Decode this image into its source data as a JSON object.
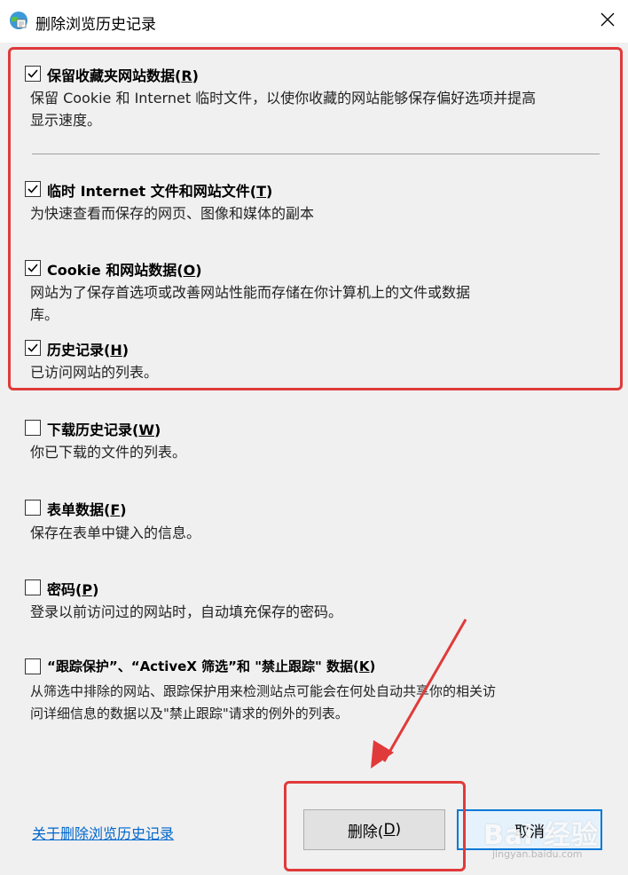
{
  "window": {
    "title": "删除浏览历史记录"
  },
  "options": [
    {
      "title": "保留收藏夹网站数据(",
      "key": "R",
      "title_end": ")",
      "checked": true,
      "desc": [
        "保留 Cookie 和 Internet 临时文件，以使你收藏的网站能够保存偏好选项并提高",
        "显示速度。"
      ]
    },
    {
      "title": "临时 Internet 文件和网站文件(",
      "key": "T",
      "title_end": ")",
      "checked": true,
      "desc": [
        "为快速查看而保存的网页、图像和媒体的副本"
      ]
    },
    {
      "title": "Cookie 和网站数据(",
      "key": "O",
      "title_end": ")",
      "checked": true,
      "desc": [
        "网站为了保存首选项或改善网站性能而存储在你计算机上的文件或数据",
        "库。"
      ]
    },
    {
      "title": "历史记录(",
      "key": "H",
      "title_end": ")",
      "checked": true,
      "desc": [
        "已访问网站的列表。"
      ]
    },
    {
      "title": "下载历史记录(",
      "key": "W",
      "title_end": ")",
      "checked": false,
      "desc": [
        "你已下载的文件的列表。"
      ]
    },
    {
      "title": "表单数据(",
      "key": "F",
      "title_end": ")",
      "checked": false,
      "desc": [
        "保存在表单中键入的信息。"
      ]
    },
    {
      "title": "密码(",
      "key": "P",
      "title_end": ")",
      "checked": false,
      "desc": [
        "登录以前访问过的网站时，自动填充保存的密码。"
      ]
    },
    {
      "title": "“跟踪保护”、“ActiveX 筛选”和 \"禁止跟踪\" 数据(",
      "key": "K",
      "title_end": ")",
      "checked": false,
      "desc": [
        "从筛选中排除的网站、跟踪保护用来检测站点可能会在何处自动共享你的相关访",
        "问详细信息的数据以及\"禁止跟踪\"请求的例外的列表。"
      ]
    }
  ],
  "footer": {
    "link": "关于删除浏览历史记录",
    "delete_label": "删除(",
    "delete_key": "D",
    "delete_end": ")",
    "cancel_label": "取消"
  },
  "watermark": {
    "text": "Bai 经验",
    "url": "jingyan.baidu.com"
  },
  "colors": {
    "highlight": "#e03a3a",
    "link": "#0066cc",
    "focus_border": "#0078d7"
  }
}
